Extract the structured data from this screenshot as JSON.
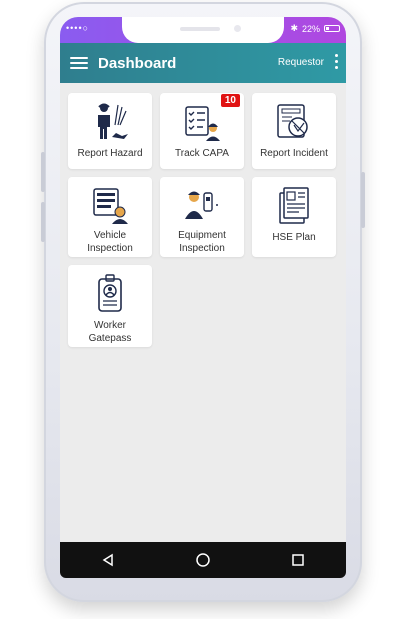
{
  "status_bar": {
    "signal": "••••○",
    "battery_text": "22%",
    "bluetooth_glyph": "✱"
  },
  "app_bar": {
    "title": "Dashboard",
    "role": "Requestor",
    "menu_icon": "hamburger-icon",
    "overflow_icon": "kebab-icon"
  },
  "tiles": [
    {
      "label": "Report Hazard",
      "icon": "worker-hazard-icon"
    },
    {
      "label": "Track CAPA",
      "icon": "checklist-worker-icon",
      "badge": "10"
    },
    {
      "label": "Report Incident",
      "icon": "incident-report-icon"
    },
    {
      "label": "Vehicle Inspection",
      "line1": "Vehicle",
      "line2": "Inspection",
      "icon": "vehicle-inspection-icon"
    },
    {
      "label": "Equipment Inspection",
      "line1": "Equipment",
      "line2": "Inspection",
      "icon": "equipment-inspection-icon"
    },
    {
      "label": "HSE Plan",
      "icon": "hse-plan-document-icon"
    },
    {
      "label": "Worker Gatepass",
      "line1": "Worker",
      "line2": "Gatepass",
      "icon": "id-badge-icon"
    }
  ],
  "nav_bar": {
    "back": "back-icon",
    "home": "home-icon",
    "recents": "recents-icon"
  },
  "colors": {
    "status_bar": "#9b52e8",
    "app_bar": "#2f8a98",
    "badge": "#e01313",
    "icon_navy": "#1f2a4a"
  }
}
